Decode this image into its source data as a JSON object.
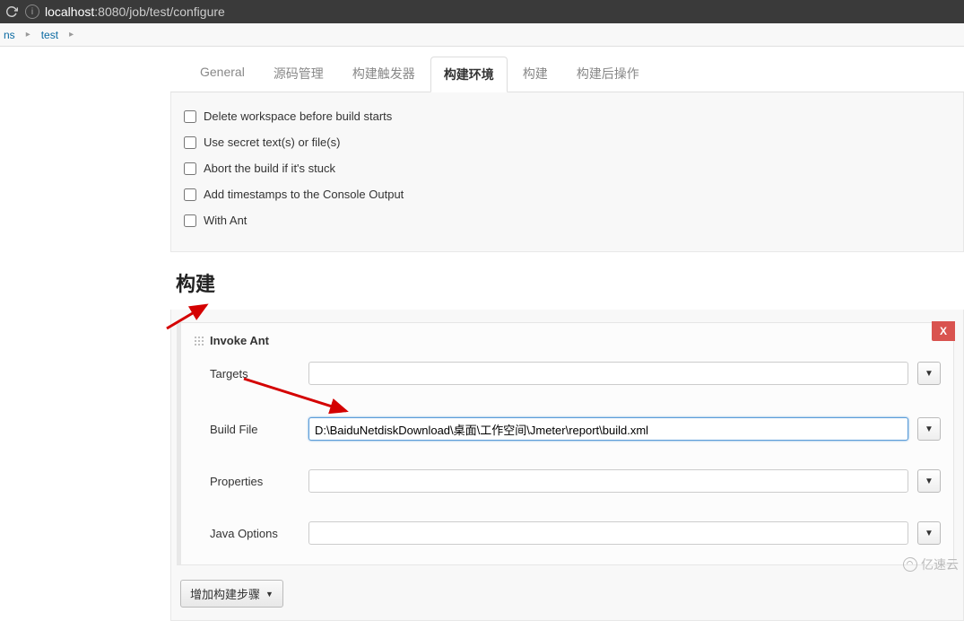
{
  "browser": {
    "url_host": "localhost",
    "url_rest": ":8080/job/test/configure"
  },
  "breadcrumb": {
    "items": [
      "ns",
      "test"
    ]
  },
  "tabs": {
    "general": "General",
    "scm": "源码管理",
    "triggers": "构建触发器",
    "env": "构建环境",
    "build": "构建",
    "postbuild": "构建后操作"
  },
  "env_options": {
    "delete_ws": "Delete workspace before build starts",
    "use_secret": "Use secret text(s) or file(s)",
    "abort_stuck": "Abort the build if it's stuck",
    "add_ts": "Add timestamps to the Console Output",
    "with_ant": "With Ant"
  },
  "build_section_title": "构建",
  "invoke_ant": {
    "title": "Invoke Ant",
    "close": "X",
    "fields": {
      "targets_label": "Targets",
      "targets_value": "",
      "buildfile_label": "Build File",
      "buildfile_value": "D:\\BaiduNetdiskDownload\\桌面\\工作空间\\Jmeter\\report\\build.xml",
      "properties_label": "Properties",
      "properties_value": "",
      "javaopts_label": "Java Options",
      "javaopts_value": ""
    }
  },
  "add_step_label": "增加构建步骤",
  "watermark_text": "亿速云"
}
